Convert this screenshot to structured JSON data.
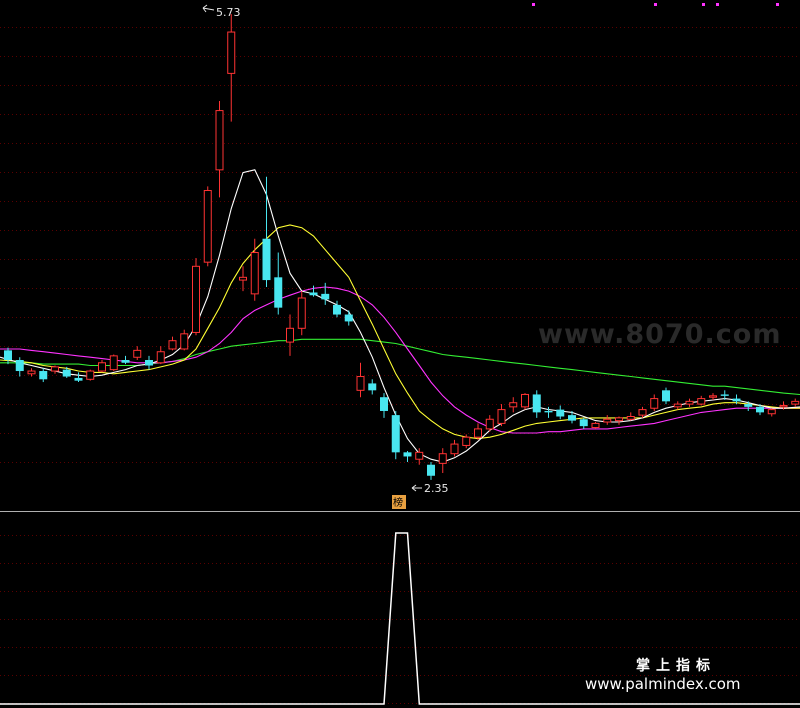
{
  "chart_data": {
    "type": "candlestick",
    "annotations": {
      "high_label": "5.73",
      "low_label": "2.35",
      "badge": "榜"
    },
    "colors": {
      "up": "#ff3333",
      "down": "#49e6f0",
      "ma_white": "#ffffff",
      "ma_yellow": "#ffff33",
      "ma_magenta": "#ff33ff",
      "ma_green": "#33ee33",
      "grid": "#5a0000",
      "indicator": "#ffffff"
    },
    "ohlc": [
      [
        3.29,
        3.31,
        3.19,
        3.22
      ],
      [
        3.22,
        3.24,
        3.1,
        3.14
      ],
      [
        3.12,
        3.16,
        3.1,
        3.14
      ],
      [
        3.14,
        3.16,
        3.06,
        3.08
      ],
      [
        3.14,
        3.18,
        3.12,
        3.17
      ],
      [
        3.15,
        3.17,
        3.09,
        3.1
      ],
      [
        3.09,
        3.13,
        3.06,
        3.07
      ],
      [
        3.08,
        3.15,
        3.07,
        3.14
      ],
      [
        3.14,
        3.22,
        3.13,
        3.2
      ],
      [
        3.15,
        3.26,
        3.14,
        3.25
      ],
      [
        3.22,
        3.25,
        3.19,
        3.2
      ],
      [
        3.24,
        3.32,
        3.22,
        3.29
      ],
      [
        3.22,
        3.25,
        3.15,
        3.18
      ],
      [
        3.2,
        3.32,
        3.19,
        3.28
      ],
      [
        3.3,
        3.39,
        3.29,
        3.36
      ],
      [
        3.3,
        3.44,
        3.29,
        3.41
      ],
      [
        3.42,
        3.96,
        3.4,
        3.9
      ],
      [
        3.93,
        4.48,
        3.9,
        4.45
      ],
      [
        4.6,
        5.1,
        4.4,
        5.03
      ],
      [
        5.3,
        5.73,
        4.95,
        5.6
      ],
      [
        3.8,
        3.9,
        3.72,
        3.82
      ],
      [
        3.7,
        4.1,
        3.65,
        4.0
      ],
      [
        4.1,
        4.55,
        3.75,
        3.8
      ],
      [
        3.82,
        4.0,
        3.55,
        3.6
      ],
      [
        3.35,
        3.55,
        3.25,
        3.45
      ],
      [
        3.45,
        3.72,
        3.4,
        3.67
      ],
      [
        3.71,
        3.76,
        3.68,
        3.69
      ],
      [
        3.7,
        3.78,
        3.62,
        3.66
      ],
      [
        3.62,
        3.65,
        3.53,
        3.55
      ],
      [
        3.55,
        3.58,
        3.47,
        3.5
      ],
      [
        3.0,
        3.2,
        2.95,
        3.1
      ],
      [
        3.05,
        3.08,
        2.97,
        3.0
      ],
      [
        2.95,
        2.98,
        2.8,
        2.85
      ],
      [
        2.82,
        2.85,
        2.5,
        2.55
      ],
      [
        2.55,
        2.56,
        2.48,
        2.52
      ],
      [
        2.5,
        2.58,
        2.46,
        2.55
      ],
      [
        2.46,
        2.48,
        2.35,
        2.38
      ],
      [
        2.47,
        2.58,
        2.4,
        2.54
      ],
      [
        2.54,
        2.64,
        2.52,
        2.61
      ],
      [
        2.6,
        2.68,
        2.58,
        2.66
      ],
      [
        2.66,
        2.76,
        2.64,
        2.72
      ],
      [
        2.72,
        2.82,
        2.7,
        2.79
      ],
      [
        2.76,
        2.9,
        2.74,
        2.86
      ],
      [
        2.88,
        2.95,
        2.84,
        2.91
      ],
      [
        2.88,
        2.98,
        2.86,
        2.97
      ],
      [
        2.97,
        3.0,
        2.8,
        2.84
      ],
      [
        2.85,
        2.88,
        2.8,
        2.84
      ],
      [
        2.86,
        2.89,
        2.79,
        2.81
      ],
      [
        2.82,
        2.85,
        2.76,
        2.78
      ],
      [
        2.79,
        2.8,
        2.72,
        2.74
      ],
      [
        2.73,
        2.77,
        2.72,
        2.76
      ],
      [
        2.77,
        2.82,
        2.75,
        2.79
      ],
      [
        2.78,
        2.81,
        2.75,
        2.8
      ],
      [
        2.79,
        2.84,
        2.78,
        2.81
      ],
      [
        2.82,
        2.88,
        2.8,
        2.86
      ],
      [
        2.87,
        2.97,
        2.85,
        2.94
      ],
      [
        3.0,
        3.02,
        2.9,
        2.92
      ],
      [
        2.88,
        2.92,
        2.86,
        2.9
      ],
      [
        2.9,
        2.94,
        2.88,
        2.92
      ],
      [
        2.9,
        2.96,
        2.89,
        2.94
      ],
      [
        2.95,
        2.98,
        2.93,
        2.96
      ],
      [
        2.97,
        3.0,
        2.93,
        2.96
      ],
      [
        2.94,
        2.97,
        2.9,
        2.92
      ],
      [
        2.9,
        2.92,
        2.85,
        2.88
      ],
      [
        2.88,
        2.9,
        2.82,
        2.84
      ],
      [
        2.83,
        2.87,
        2.81,
        2.86
      ],
      [
        2.88,
        2.92,
        2.86,
        2.89
      ],
      [
        2.9,
        2.94,
        2.88,
        2.92
      ]
    ],
    "ma_white": [
      3.24,
      3.2,
      3.18,
      3.16,
      3.14,
      3.12,
      3.11,
      3.1,
      3.11,
      3.13,
      3.15,
      3.18,
      3.19,
      3.22,
      3.26,
      3.33,
      3.47,
      3.68,
      3.98,
      4.32,
      4.58,
      4.6,
      4.42,
      4.12,
      3.85,
      3.72,
      3.7,
      3.66,
      3.62,
      3.57,
      3.42,
      3.24,
      3.02,
      2.82,
      2.65,
      2.54,
      2.5,
      2.48,
      2.51,
      2.56,
      2.63,
      2.71,
      2.76,
      2.82,
      2.86,
      2.88,
      2.86,
      2.85,
      2.84,
      2.81,
      2.78,
      2.77,
      2.77,
      2.78,
      2.8,
      2.84,
      2.87,
      2.89,
      2.91,
      2.92,
      2.93,
      2.94,
      2.93,
      2.91,
      2.89,
      2.87,
      2.87,
      2.88
    ],
    "ma_yellow": [
      3.22,
      3.21,
      3.2,
      3.18,
      3.17,
      3.16,
      3.14,
      3.13,
      3.13,
      3.12,
      3.13,
      3.14,
      3.15,
      3.17,
      3.19,
      3.22,
      3.3,
      3.45,
      3.6,
      3.78,
      3.92,
      4.02,
      4.1,
      4.18,
      4.2,
      4.18,
      4.12,
      4.02,
      3.92,
      3.82,
      3.65,
      3.48,
      3.3,
      3.12,
      2.98,
      2.85,
      2.78,
      2.72,
      2.68,
      2.66,
      2.65,
      2.66,
      2.68,
      2.71,
      2.74,
      2.76,
      2.77,
      2.78,
      2.79,
      2.8,
      2.8,
      2.8,
      2.8,
      2.8,
      2.8,
      2.82,
      2.84,
      2.86,
      2.87,
      2.88,
      2.9,
      2.91,
      2.91,
      2.9,
      2.89,
      2.88,
      2.87,
      2.87
    ],
    "ma_magenta": [
      3.3,
      3.3,
      3.29,
      3.28,
      3.27,
      3.26,
      3.25,
      3.24,
      3.23,
      3.22,
      3.21,
      3.2,
      3.2,
      3.2,
      3.21,
      3.22,
      3.24,
      3.28,
      3.34,
      3.42,
      3.52,
      3.58,
      3.62,
      3.66,
      3.69,
      3.72,
      3.74,
      3.75,
      3.74,
      3.72,
      3.68,
      3.62,
      3.53,
      3.42,
      3.3,
      3.18,
      3.06,
      2.96,
      2.88,
      2.82,
      2.77,
      2.73,
      2.7,
      2.69,
      2.69,
      2.69,
      2.7,
      2.7,
      2.71,
      2.72,
      2.72,
      2.72,
      2.73,
      2.74,
      2.75,
      2.76,
      2.78,
      2.8,
      2.82,
      2.84,
      2.85,
      2.86,
      2.87,
      2.87,
      2.87,
      2.87,
      2.87,
      2.87
    ],
    "ma_green": [
      3.2,
      3.2,
      3.2,
      3.19,
      3.19,
      3.19,
      3.19,
      3.18,
      3.18,
      3.18,
      3.18,
      3.18,
      3.19,
      3.2,
      3.21,
      3.23,
      3.26,
      3.28,
      3.3,
      3.32,
      3.33,
      3.34,
      3.35,
      3.36,
      3.36,
      3.37,
      3.37,
      3.37,
      3.37,
      3.37,
      3.37,
      3.36,
      3.35,
      3.34,
      3.32,
      3.3,
      3.28,
      3.26,
      3.25,
      3.24,
      3.23,
      3.22,
      3.21,
      3.2,
      3.19,
      3.18,
      3.17,
      3.16,
      3.15,
      3.14,
      3.13,
      3.12,
      3.11,
      3.1,
      3.09,
      3.08,
      3.07,
      3.06,
      3.05,
      3.04,
      3.03,
      3.03,
      3.02,
      3.01,
      3.0,
      2.99,
      2.98,
      2.97
    ],
    "indicator": [
      0,
      0,
      0,
      0,
      0,
      0,
      0,
      0,
      0,
      0,
      0,
      0,
      0,
      0,
      0,
      0,
      0,
      0,
      0,
      0,
      0,
      0,
      0,
      0,
      0,
      0,
      0,
      0,
      0,
      0,
      0,
      0,
      0,
      1,
      1,
      0,
      0,
      0,
      0,
      0,
      0,
      0,
      0,
      0,
      0,
      0,
      0,
      0,
      0,
      0,
      0,
      0,
      0,
      0,
      0,
      0,
      0,
      0,
      0,
      0,
      0,
      0,
      0,
      0,
      0,
      0,
      0,
      0
    ],
    "watermarks": {
      "site": "www.8070.com",
      "brand_cn": "掌上指标",
      "brand_url": "www.palmindex.com"
    }
  }
}
